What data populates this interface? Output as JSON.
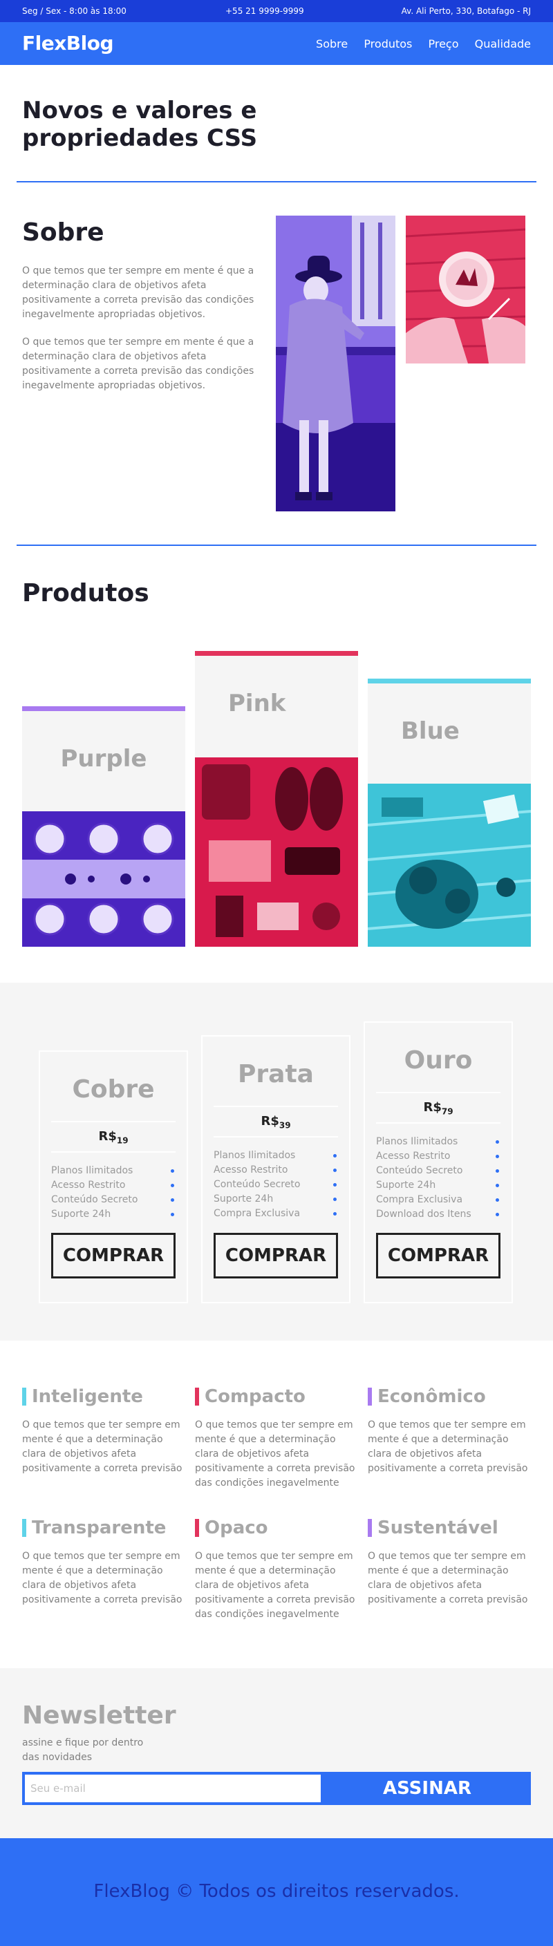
{
  "topbar": {
    "hours": "Seg / Sex - 8:00 às 18:00",
    "phone": "+55 21 9999-9999",
    "address": "Av. Ali Perto, 330, Botafago - RJ"
  },
  "header": {
    "logo": "FlexBlog",
    "nav": [
      "Sobre",
      "Produtos",
      "Preço",
      "Qualidade"
    ]
  },
  "intro": {
    "title": "Novos e valores e propriedades CSS"
  },
  "about": {
    "title": "Sobre",
    "paragraphs": [
      "O que temos que ter sempre em mente é que a determinação clara de objetivos afeta positivamente a correta previsão das condições inegavelmente apropriadas objetivos.",
      "O que temos que ter sempre em mente é que a determinação clara de objetivos afeta positivamente a correta previsão das condições inegavelmente apropriadas objetivos."
    ]
  },
  "products": {
    "title": "Produtos",
    "items": [
      {
        "name": "Purple",
        "color": "#a87af0"
      },
      {
        "name": "Pink",
        "color": "#e2335c"
      },
      {
        "name": "Blue",
        "color": "#5fd3e8"
      }
    ]
  },
  "pricing": {
    "plans": [
      {
        "name": "Cobre",
        "currency": "R$",
        "amount": "19",
        "features": [
          "Planos Ilimitados",
          "Acesso Restrito",
          "Conteúdo Secreto",
          "Suporte 24h"
        ],
        "cta": "COMPRAR"
      },
      {
        "name": "Prata",
        "currency": "R$",
        "amount": "39",
        "features": [
          "Planos Ilimitados",
          "Acesso Restrito",
          "Conteúdo Secreto",
          "Suporte 24h",
          "Compra Exclusiva"
        ],
        "cta": "COMPRAR"
      },
      {
        "name": "Ouro",
        "currency": "R$",
        "amount": "79",
        "features": [
          "Planos Ilimitados",
          "Acesso Restrito",
          "Conteúdo Secreto",
          "Suporte 24h",
          "Compra Exclusiva",
          "Download dos Itens"
        ],
        "cta": "COMPRAR"
      }
    ]
  },
  "features": {
    "items": [
      {
        "title": "Inteligente",
        "color": "#5fd3e8",
        "text": "O que temos que ter sempre em mente é que a determinação clara de objetivos afeta positivamente a correta previsão"
      },
      {
        "title": "Compacto",
        "color": "#e2335c",
        "text": "O que temos que ter sempre em mente é que a determinação clara de objetivos afeta positivamente a correta previsão das condições inegavelmente"
      },
      {
        "title": "Econômico",
        "color": "#a87af0",
        "text": "O que temos que ter sempre em mente é que a determinação clara de objetivos afeta positivamente a correta previsão"
      },
      {
        "title": "Transparente",
        "color": "#5fd3e8",
        "text": "O que temos que ter sempre em mente é que a determinação clara de objetivos afeta positivamente a correta previsão"
      },
      {
        "title": "Opaco",
        "color": "#e2335c",
        "text": "O que temos que ter sempre em mente é que a determinação clara de objetivos afeta positivamente a correta previsão das condições inegavelmente"
      },
      {
        "title": "Sustentável",
        "color": "#a87af0",
        "text": "O que temos que ter sempre em mente é que a determinação clara de objetivos afeta positivamente a correta previsão"
      }
    ]
  },
  "newsletter": {
    "title": "Newsletter",
    "subtitle": "assine e fique por dentro das novidades",
    "placeholder": "Seu e-mail",
    "button": "ASSINAR"
  },
  "footer": {
    "text": "FlexBlog © Todos os direitos reservados."
  }
}
